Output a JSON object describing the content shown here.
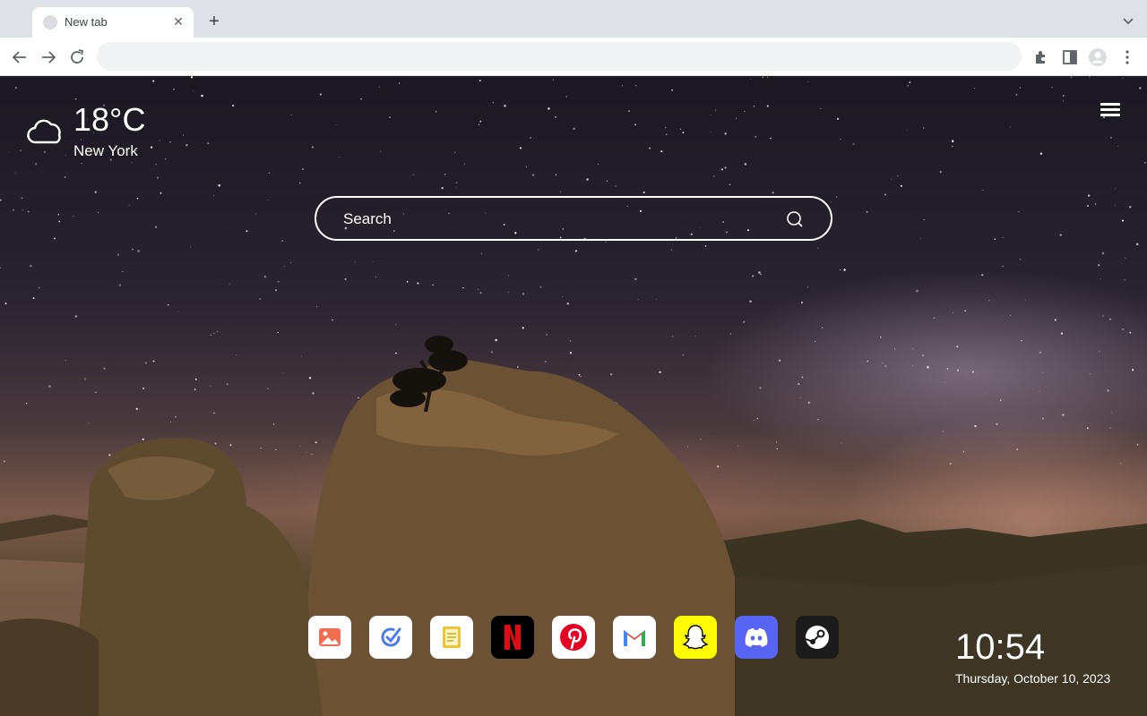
{
  "browser": {
    "tab": {
      "title": "New tab",
      "favicon": "globe-icon"
    },
    "omnibox": {
      "value": "",
      "placeholder": ""
    }
  },
  "weather": {
    "temperature": "18°C",
    "city": "New York",
    "icon": "cloud-icon"
  },
  "search": {
    "placeholder": "Search"
  },
  "apps": [
    {
      "name": "photos",
      "icon": "image-icon",
      "bg": "#ffffff",
      "accent": "#f26d4f"
    },
    {
      "name": "tasks",
      "icon": "check-icon",
      "bg": "#ffffff",
      "accent": "#4b7bec"
    },
    {
      "name": "notes",
      "icon": "note-icon",
      "bg": "#ffffff",
      "accent": "#f4c430"
    },
    {
      "name": "netflix",
      "icon": "netflix-icon",
      "bg": "#000000",
      "accent": "#e50914"
    },
    {
      "name": "pinterest",
      "icon": "pinterest-icon",
      "bg": "#ffffff",
      "accent": "#e60023"
    },
    {
      "name": "gmail",
      "icon": "gmail-icon",
      "bg": "#ffffff",
      "accent": "#ea4335"
    },
    {
      "name": "snapchat",
      "icon": "snapchat-icon",
      "bg": "#fffc00",
      "accent": "#ffffff"
    },
    {
      "name": "discord",
      "icon": "discord-icon",
      "bg": "#5865f2",
      "accent": "#ffffff"
    },
    {
      "name": "steam",
      "icon": "steam-icon",
      "bg": "#1b1b1b",
      "accent": "#ffffff"
    }
  ],
  "clock": {
    "time": "10:54",
    "date": "Thursday, October 10, 2023"
  }
}
